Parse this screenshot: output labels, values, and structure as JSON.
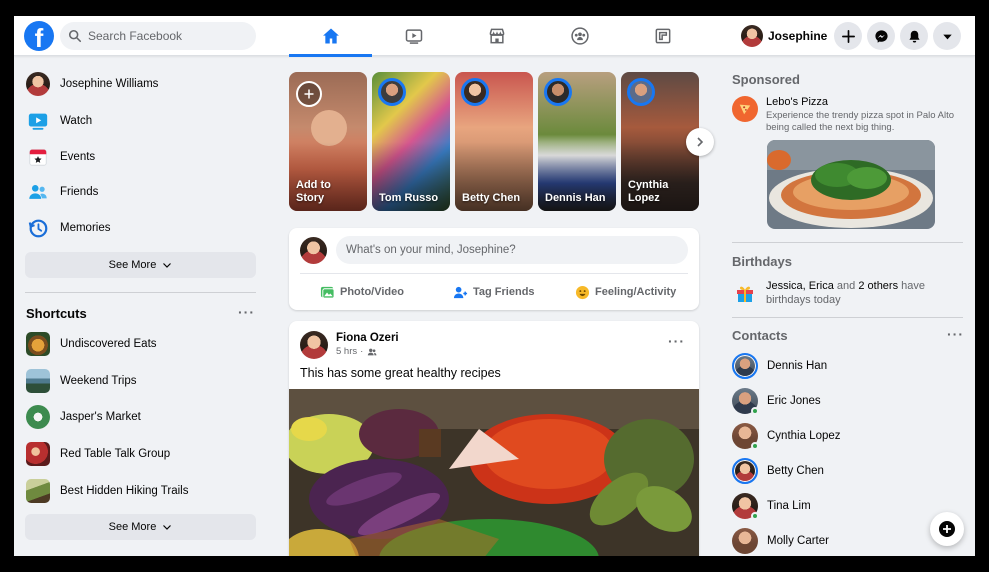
{
  "app": {
    "logo_letter": "f"
  },
  "header": {
    "search_placeholder": "Search Facebook",
    "tabs": [
      {
        "icon": "home-icon",
        "active": true
      },
      {
        "icon": "watch-icon",
        "active": false
      },
      {
        "icon": "marketplace-icon",
        "active": false
      },
      {
        "icon": "groups-icon",
        "active": false
      },
      {
        "icon": "gaming-icon",
        "active": false
      }
    ],
    "profile_name": "Josephine",
    "actions": [
      "plus-icon",
      "messenger-icon",
      "bell-icon",
      "caret-down-icon"
    ]
  },
  "sidebar": {
    "items": [
      {
        "label": "Josephine Williams",
        "icon": "avatar"
      },
      {
        "label": "Watch",
        "icon": "watch-icon"
      },
      {
        "label": "Events",
        "icon": "calendar-star-icon"
      },
      {
        "label": "Friends",
        "icon": "friends-icon"
      },
      {
        "label": "Memories",
        "icon": "memories-clock-icon"
      }
    ],
    "see_more": "See More",
    "shortcuts_title": "Shortcuts",
    "shortcuts": [
      {
        "label": "Undiscovered Eats"
      },
      {
        "label": "Weekend Trips"
      },
      {
        "label": "Jasper's Market"
      },
      {
        "label": "Red Table Talk Group"
      },
      {
        "label": "Best Hidden Hiking Trails"
      }
    ],
    "shortcuts_see_more": "See More"
  },
  "stories": [
    {
      "name": "Add to Story"
    },
    {
      "name": "Tom Russo"
    },
    {
      "name": "Betty Chen"
    },
    {
      "name": "Dennis Han"
    },
    {
      "name": "Cynthia Lopez"
    }
  ],
  "composer": {
    "placeholder": "What's on your mind, Josephine?",
    "photo_video": "Photo/Video",
    "tag_friends": "Tag Friends",
    "feeling": "Feeling/Activity"
  },
  "post": {
    "author": "Fiona Ozeri",
    "time": "5 hrs",
    "audience_icon": "friends-audience-icon",
    "text": "This has some great healthy recipes"
  },
  "sponsored": {
    "title": "Sponsored",
    "name": "Lebo's Pizza",
    "desc": "Experience the trendy pizza spot in Palo Alto being called the next big thing."
  },
  "birthdays": {
    "title": "Birthdays",
    "names": "Jessica, Erica",
    "and": "and",
    "others": "2 others",
    "suffix": "have birthdays today"
  },
  "contacts": {
    "title": "Contacts",
    "list": [
      {
        "name": "Dennis Han",
        "online": false,
        "story": true
      },
      {
        "name": "Eric Jones",
        "online": true,
        "story": false
      },
      {
        "name": "Cynthia Lopez",
        "online": true,
        "story": false
      },
      {
        "name": "Betty Chen",
        "online": false,
        "story": true
      },
      {
        "name": "Tina Lim",
        "online": true,
        "story": false
      },
      {
        "name": "Molly Carter",
        "online": false,
        "story": false
      }
    ]
  },
  "colors": {
    "brand": "#1877f2",
    "online": "#31a24c",
    "background": "#f0f2f5"
  }
}
